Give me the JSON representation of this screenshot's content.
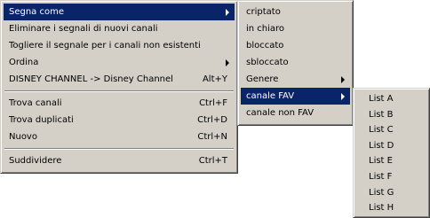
{
  "main_menu": {
    "items": [
      {
        "label": "Segna come",
        "shortcut": "",
        "submenu": true,
        "selected": true
      },
      {
        "label": "Eliminare i segnali di nuovi canali",
        "shortcut": "",
        "submenu": false
      },
      {
        "label": "Togliere il segnale per i canali non esistenti",
        "shortcut": "",
        "submenu": false
      },
      {
        "label": "Ordina",
        "shortcut": "",
        "submenu": true
      },
      {
        "label": "DISNEY CHANNEL -> Disney Channel",
        "shortcut": "Alt+Y",
        "submenu": false
      },
      {
        "label": "Trova canali",
        "shortcut": "Ctrl+F",
        "submenu": false
      },
      {
        "label": "Trova duplicati",
        "shortcut": "Ctrl+D",
        "submenu": false
      },
      {
        "label": "Nuovo",
        "shortcut": "Ctrl+N",
        "submenu": false
      },
      {
        "label": "Suddividere",
        "shortcut": "Ctrl+T",
        "submenu": false
      }
    ]
  },
  "mark_submenu": {
    "items": [
      {
        "label": "criptato"
      },
      {
        "label": "in chiaro"
      },
      {
        "label": "bloccato"
      },
      {
        "label": "sbloccato"
      },
      {
        "label": "Genere"
      },
      {
        "label": "canale FAV"
      },
      {
        "label": "canale non FAV"
      }
    ]
  },
  "fav_list_submenu": {
    "items": [
      {
        "label": "List A"
      },
      {
        "label": "List B"
      },
      {
        "label": "List C"
      },
      {
        "label": "List D"
      },
      {
        "label": "List E"
      },
      {
        "label": "List F"
      },
      {
        "label": "List G"
      },
      {
        "label": "List H"
      }
    ]
  },
  "colors": {
    "menu_background": "#d4d0c8",
    "selection_background": "#0a246a",
    "selection_text": "#ffffff"
  }
}
